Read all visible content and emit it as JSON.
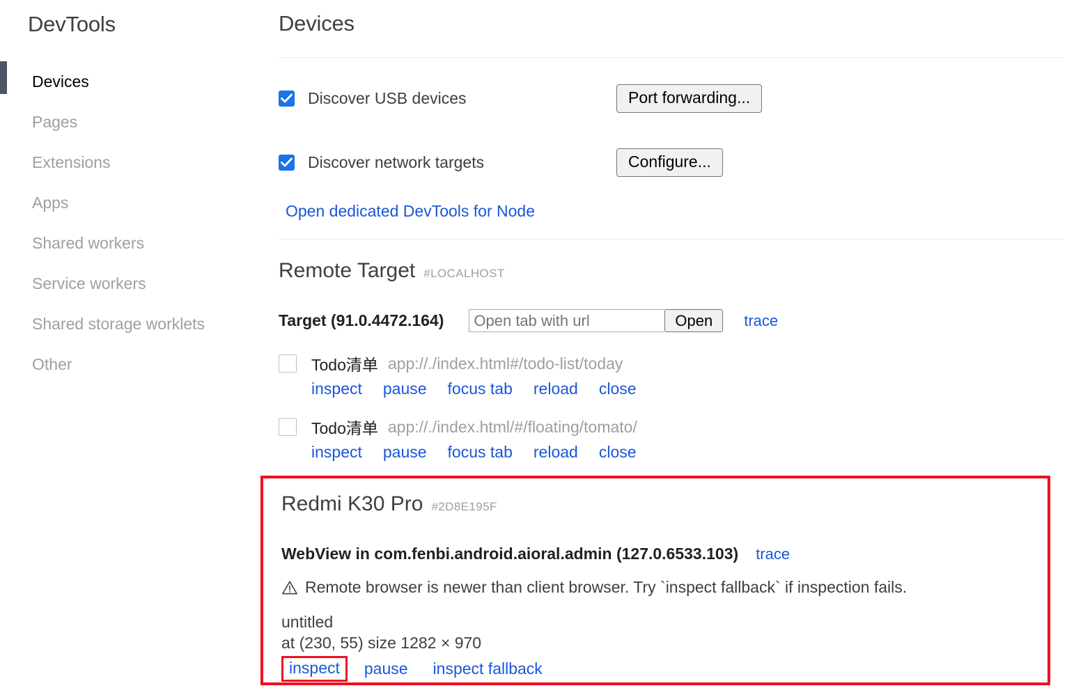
{
  "sidebar": {
    "title": "DevTools",
    "items": [
      {
        "label": "Devices",
        "selected": true
      },
      {
        "label": "Pages",
        "selected": false
      },
      {
        "label": "Extensions",
        "selected": false
      },
      {
        "label": "Apps",
        "selected": false
      },
      {
        "label": "Shared workers",
        "selected": false
      },
      {
        "label": "Service workers",
        "selected": false
      },
      {
        "label": "Shared storage worklets",
        "selected": false
      },
      {
        "label": "Other",
        "selected": false
      }
    ]
  },
  "main": {
    "page_title": "Devices",
    "discovery": {
      "usb_label": "Discover USB devices",
      "usb_checked": true,
      "port_forwarding_button": "Port forwarding...",
      "network_label": "Discover network targets",
      "network_checked": true,
      "configure_button": "Configure...",
      "node_link": "Open dedicated DevTools for Node"
    },
    "remote_target": {
      "heading": "Remote Target",
      "hash": "#LOCALHOST",
      "target_label": "Target (91.0.4472.164)",
      "url_placeholder": "Open tab with url",
      "url_value": "",
      "open_button": "Open",
      "trace_link": "trace",
      "entries": [
        {
          "name": "Todo清单",
          "url": "app://./index.html#/todo-list/today",
          "checked": false,
          "actions": [
            "inspect",
            "pause",
            "focus tab",
            "reload",
            "close"
          ]
        },
        {
          "name": "Todo清单",
          "url": "app://./index.html/#/floating/tomato/",
          "checked": false,
          "actions": [
            "inspect",
            "pause",
            "focus tab",
            "reload",
            "close"
          ]
        }
      ]
    },
    "device_panel": {
      "highlighted": true,
      "highlight_color": "#f01020",
      "device_name": "Redmi K30 Pro",
      "device_hash": "#2D8E195F",
      "webview_title": "WebView in com.fenbi.android.aioral.admin (127.0.6533.103)",
      "webview_trace": "trace",
      "warning_icon": "warning-triangle-icon",
      "warning_text": "Remote browser is newer than client browser. Try `inspect fallback` if inspection fails.",
      "target_title": "untitled",
      "target_geometry": "at (230, 55)  size 1282 × 970",
      "actions": {
        "inspect": "inspect",
        "pause": "pause",
        "inspect_fallback": "inspect fallback"
      }
    }
  },
  "colors": {
    "accent_link": "#1a56db",
    "checkbox_blue": "#1a73e8",
    "highlight_red": "#f01020",
    "selected_bar": "#4b5563",
    "muted_text": "#9aa0a6"
  }
}
